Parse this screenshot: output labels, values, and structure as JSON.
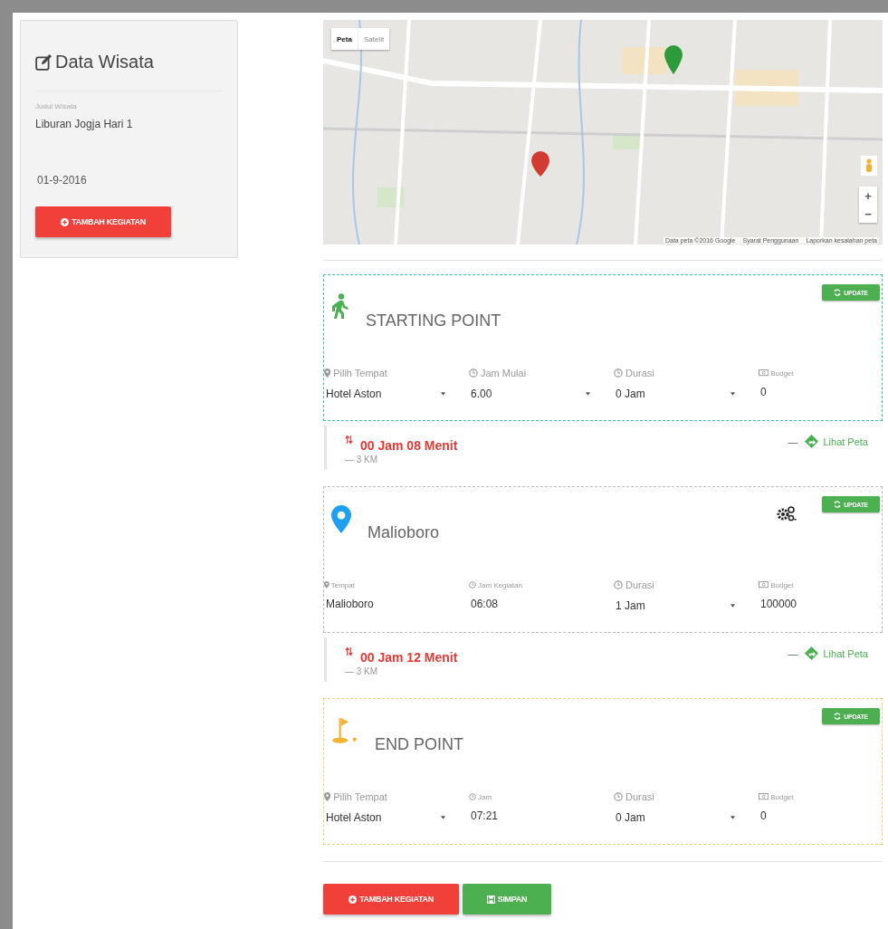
{
  "sidebar": {
    "title": "Data Wisata",
    "field_label": "Judul Wisata",
    "field_value": "Liburan Jogja Hari 1",
    "date": "01-9-2016",
    "button": "TAMBAH KEGIATAN"
  },
  "map": {
    "type_buttons": [
      {
        "label": "Peta",
        "selected": true
      },
      {
        "label": "Satelit",
        "selected": false
      }
    ],
    "zoom_in": "+",
    "zoom_out": "−",
    "attribution": [
      "Data peta ©2016 Google",
      "Syarat Penggunaan",
      "Laporkan kesalahan peta"
    ]
  },
  "stops": [
    {
      "kind": "start",
      "title": "STARTING POINT",
      "color": "#3cc6a8",
      "menu": false,
      "update": "UPDATE",
      "fields": [
        {
          "label": "Pilih Tempat",
          "small": false,
          "kind": "select",
          "value": "Hotel Aston"
        },
        {
          "label": "Jam Mulai",
          "small": false,
          "kind": "select",
          "value": "6.00"
        },
        {
          "label": "Durasi",
          "small": false,
          "kind": "select",
          "value": "0 Jam"
        },
        {
          "label": "Budget",
          "small": true,
          "kind": "text",
          "value": "0"
        }
      ],
      "leg": {
        "duration": "00 Jam 08 Menit",
        "distance": "— 3 KM",
        "separator": "—",
        "link": "Lihat Peta"
      }
    },
    {
      "kind": "place",
      "title": "Malioboro",
      "color": "#bbbbbb",
      "menu": true,
      "update": "UPDATE",
      "fields": [
        {
          "label": "Tempat",
          "small": true,
          "kind": "text",
          "value": "Malioboro"
        },
        {
          "label": "Jam Kegiatan",
          "small": true,
          "kind": "text",
          "value": "06:08"
        },
        {
          "label": "Durasi",
          "small": false,
          "kind": "select",
          "value": "1 Jam"
        },
        {
          "label": "Budget",
          "small": true,
          "kind": "text",
          "value": "100000"
        }
      ],
      "leg": {
        "duration": "00 Jam 12 Menit",
        "distance": "— 3 KM",
        "separator": "—",
        "link": "Lihat Peta"
      }
    },
    {
      "kind": "end",
      "title": "END POINT",
      "color": "#f3d27a",
      "menu": false,
      "update": "UPDATE",
      "fields": [
        {
          "label": "Pilih Tempat",
          "small": false,
          "kind": "select",
          "value": "Hotel Aston"
        },
        {
          "label": "Jam",
          "small": true,
          "kind": "text",
          "value": "07:21"
        },
        {
          "label": "Durasi",
          "small": false,
          "kind": "select",
          "value": "0 Jam"
        },
        {
          "label": "Budget",
          "small": true,
          "kind": "text",
          "value": "0"
        }
      ]
    }
  ],
  "actions": [
    {
      "kind": "add",
      "label": "TAMBAH KEGIATAN"
    },
    {
      "kind": "save",
      "label": "SIMPAN"
    }
  ]
}
